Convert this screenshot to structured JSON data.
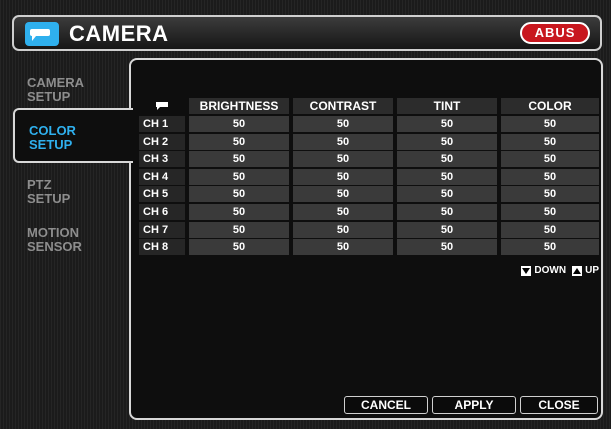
{
  "header": {
    "title": "CAMERA",
    "brand": "ABUS"
  },
  "sidebar": {
    "items": [
      {
        "label_line1": "CAMERA",
        "label_line2": "SETUP"
      },
      {
        "label_line1": "COLOR",
        "label_line2": "SETUP"
      },
      {
        "label_line1": "PTZ",
        "label_line2": "SETUP"
      },
      {
        "label_line1": "MOTION",
        "label_line2": "SENSOR"
      }
    ]
  },
  "table": {
    "columns": [
      "BRIGHTNESS",
      "CONTRAST",
      "TINT",
      "COLOR"
    ],
    "rows": [
      {
        "channel": "CH 1",
        "values": [
          "50",
          "50",
          "50",
          "50"
        ]
      },
      {
        "channel": "CH 2",
        "values": [
          "50",
          "50",
          "50",
          "50"
        ]
      },
      {
        "channel": "CH 3",
        "values": [
          "50",
          "50",
          "50",
          "50"
        ]
      },
      {
        "channel": "CH 4",
        "values": [
          "50",
          "50",
          "50",
          "50"
        ]
      },
      {
        "channel": "CH 5",
        "values": [
          "50",
          "50",
          "50",
          "50"
        ]
      },
      {
        "channel": "CH 6",
        "values": [
          "50",
          "50",
          "50",
          "50"
        ]
      },
      {
        "channel": "CH 7",
        "values": [
          "50",
          "50",
          "50",
          "50"
        ]
      },
      {
        "channel": "CH 8",
        "values": [
          "50",
          "50",
          "50",
          "50"
        ]
      }
    ]
  },
  "paging": {
    "down_label": "DOWN",
    "up_label": "UP"
  },
  "buttons": {
    "cancel": "CANCEL",
    "apply": "APPLY",
    "close": "CLOSE"
  },
  "colors": {
    "accent": "#2fb0ee",
    "brand": "#c8171e"
  }
}
